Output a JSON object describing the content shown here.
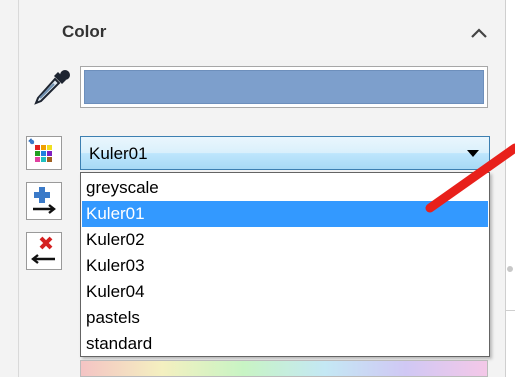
{
  "panel": {
    "title": "Color",
    "swatch_color": "#7d9fcc"
  },
  "palette_select": {
    "selected": "Kuler01",
    "options": [
      "greyscale",
      "Kuler01",
      "Kuler02",
      "Kuler03",
      "Kuler04",
      "pastels",
      "standard"
    ],
    "selected_index": 1
  },
  "colors": {
    "selection_highlight": "#3399ff",
    "annotation_arrow": "#e8201b"
  },
  "icons": {
    "collapse": "chevron-up-icon",
    "eyedropper": "eyedropper-icon",
    "palette": "palette-grid-icon",
    "add": "add-color-icon",
    "remove": "remove-color-icon"
  }
}
